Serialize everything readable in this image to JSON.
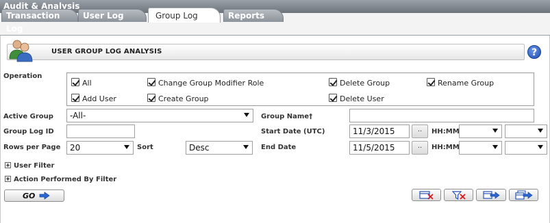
{
  "window": {
    "title": "Audit & Analysis"
  },
  "tabs": [
    {
      "label": "Transaction Log"
    },
    {
      "label": "User Log"
    },
    {
      "label": "Group Log",
      "active": true
    },
    {
      "label": "Reports"
    }
  ],
  "section": {
    "title": "USER GROUP LOG ANALYSIS",
    "icon": "users-icon",
    "help_icon": "help-icon",
    "help_glyph": "?"
  },
  "operation": {
    "label": "Operation",
    "options": [
      {
        "label": "All",
        "checked": true
      },
      {
        "label": "Change Group Modifier Role",
        "checked": true
      },
      {
        "label": "Delete Group",
        "checked": true
      },
      {
        "label": "Rename Group",
        "checked": true
      },
      {
        "label": "Add User",
        "checked": true
      },
      {
        "label": "Create Group",
        "checked": true
      },
      {
        "label": "Delete User",
        "checked": true
      }
    ]
  },
  "fields": {
    "active_group": {
      "label": "Active Group",
      "value": "-All-"
    },
    "group_name": {
      "label": "Group Name†",
      "value": ""
    },
    "group_log_id": {
      "label": "Group Log ID",
      "value": ""
    },
    "start_date": {
      "label": "Start Date (UTC)",
      "value": "11/3/2015",
      "btn": "..",
      "hhmm_label": "HH:MM"
    },
    "rows_per_page": {
      "label": "Rows per Page",
      "value": "20"
    },
    "sort": {
      "label": "Sort",
      "value": "Desc"
    },
    "end_date": {
      "label": "End Date",
      "value": "11/5/2015",
      "btn": "..",
      "hhmm_label": "HH:MM"
    }
  },
  "filters": {
    "user_filter": "User Filter",
    "action_filter": "Action Performed By Filter"
  },
  "buttons": {
    "go": "GO"
  },
  "colors": {
    "title_bar": "#7d838a",
    "tab_inactive": "#a3a8ae",
    "icon_blue": "#1f4fb5",
    "icon_red": "#d81b1b"
  }
}
